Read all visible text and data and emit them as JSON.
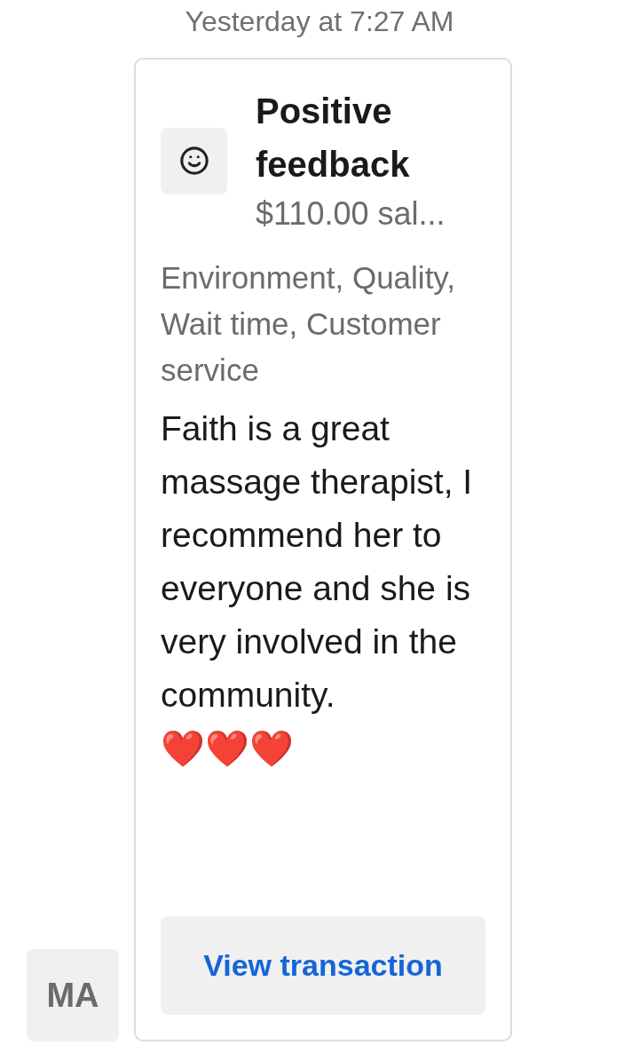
{
  "timestamp": "Yesterday at 7:27 AM",
  "avatar": {
    "initials": "MA"
  },
  "card": {
    "title": "Positive feedback",
    "subtitle": "$110.00 sal...",
    "tags": "Environment, Quality, Wait time, Customer service",
    "message": "Faith is a great massage therapist, I recommend her to everyone and she is very involved in the community.",
    "emoji": "❤️❤️❤️",
    "button": "View transaction"
  }
}
